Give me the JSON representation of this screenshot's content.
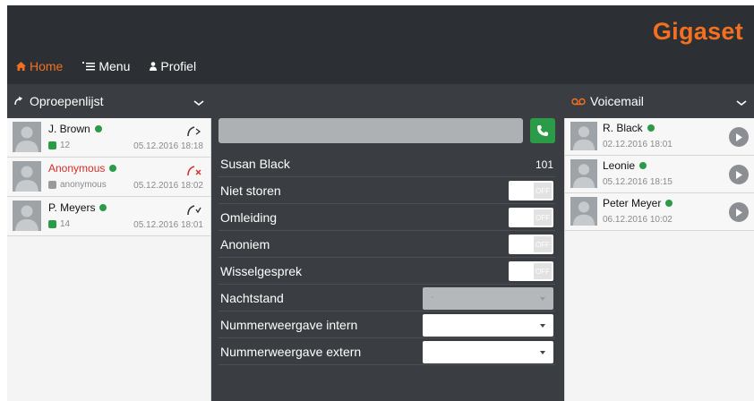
{
  "brand": {
    "logo_text": "Gigaset",
    "accent": "#f37021"
  },
  "nav": {
    "home": "Home",
    "menu": "Menu",
    "profile": "Profiel"
  },
  "calllist": {
    "title": "Oproepenlijst",
    "items": [
      {
        "name": "J. Brown",
        "sub": "12",
        "date": "05.12.2016 18:18",
        "type": "outgoing",
        "status": "online"
      },
      {
        "name": "Anonymous",
        "sub": "anonymous",
        "date": "05.12.2016 18:02",
        "type": "missed",
        "status": "online"
      },
      {
        "name": "P. Meyers",
        "sub": "14",
        "date": "05.12.2016 18:01",
        "type": "incoming",
        "status": "online"
      }
    ]
  },
  "voicemail": {
    "title": "Voicemail",
    "items": [
      {
        "name": "R. Black",
        "date": "02.12.2016 18:01"
      },
      {
        "name": "Leonie",
        "date": "05.12.2016 18:15"
      },
      {
        "name": "Peter Meyer",
        "date": "06.12.2016 10:02"
      }
    ]
  },
  "center": {
    "dial_value": "",
    "user_name": "Susan Black",
    "user_ext": "101",
    "dnd_label": "Niet storen",
    "forward_label": "Omleiding",
    "anonymous_label": "Anoniem",
    "callwaiting_label": "Wisselgesprek",
    "night_label": "Nachtstand",
    "night_value": "-",
    "clip_int_label": "Nummerweergave intern",
    "clip_ext_label": "Nummerweergave extern",
    "toggle_off": "OFF"
  },
  "colors": {
    "green": "#2c9b47",
    "red": "#d62d27",
    "dark": "#2c2f33",
    "panel": "#3a3d41"
  }
}
